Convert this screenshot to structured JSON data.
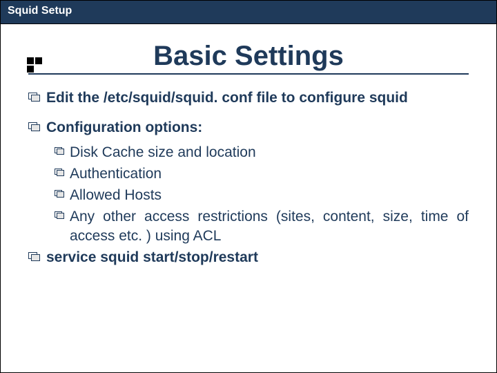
{
  "header": {
    "title": "Squid Setup"
  },
  "title": "Basic Settings",
  "bullets": [
    {
      "text": "Edit the /etc/squid/squid. conf file to configure squid"
    },
    {
      "text": "Configuration options:",
      "sub": [
        "Disk Cache size and location",
        "Authentication",
        "Allowed Hosts",
        "Any other access restrictions (sites, content, size, time of access etc. )  using ACL"
      ]
    },
    {
      "text": "service squid start/stop/restart",
      "boldOnly": true
    }
  ]
}
